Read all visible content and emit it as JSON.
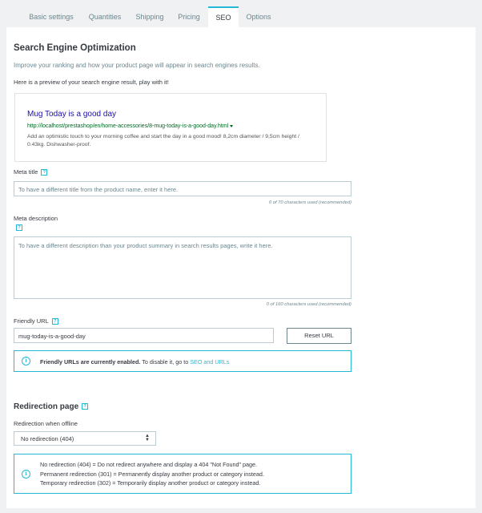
{
  "tabs": [
    {
      "label": "Basic settings"
    },
    {
      "label": "Quantities"
    },
    {
      "label": "Shipping"
    },
    {
      "label": "Pricing"
    },
    {
      "label": "SEO"
    },
    {
      "label": "Options"
    }
  ],
  "active_tab": "SEO",
  "seo": {
    "title": "Search Engine Optimization",
    "subtitle": "Improve your ranking and how your product page will appear in search engines results.",
    "preview_label": "Here is a preview of your search engine result, play with it!",
    "preview": {
      "title": "Mug Today is a good day",
      "url": "http://localhost/prestashop/en/home-accessories/8-mug-today-is-a-good-day.html",
      "description": "Add an optimistic touch to your morning coffee and start the day in a good mood! 8,2cm diameter / 9,5cm height / 0.43kg. Dishwasher-proof."
    },
    "meta_title": {
      "label": "Meta title",
      "placeholder": "To have a different title from the product name, enter it here.",
      "counter": "0 of 70 characters used (recommended)"
    },
    "meta_description": {
      "label": "Meta description",
      "placeholder": "To have a different description than your product summary in search results pages, write it here.",
      "counter": "0 of 160 characters used (recommended)"
    },
    "friendly_url": {
      "label": "Friendly URL",
      "value": "mug-today-is-a-good-day",
      "reset_label": "Reset URL"
    },
    "friendly_alert": {
      "bold": "Friendly URLs are currently enabled.",
      "text": " To disable it, go to ",
      "link": "SEO and URLs"
    }
  },
  "redirection": {
    "title": "Redirection page",
    "label": "Redirection when offline",
    "selected": "No redirection (404)",
    "info_lines": [
      "No redirection (404) = Do not redirect anywhere and display a 404 \"Not Found\" page.",
      "Permanent redirection (301) = Permanently display another product or category instead.",
      "Temporary redirection (302) = Temporarily display another product or category instead."
    ]
  },
  "colors": {
    "accent": "#25b9d7",
    "preview_title": "#1a0dab",
    "preview_url": "#006621"
  },
  "icons": {
    "help": "?",
    "info": "i",
    "select_arrows": "⬍"
  }
}
